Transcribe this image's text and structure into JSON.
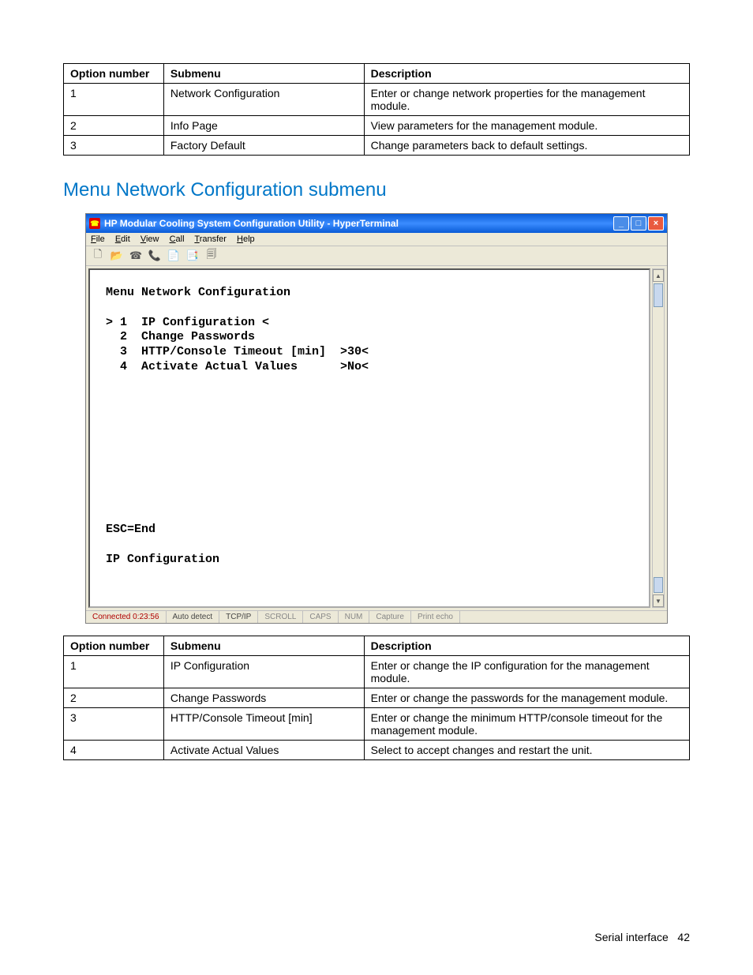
{
  "table1": {
    "headers": {
      "c1": "Option number",
      "c2": "Submenu",
      "c3": "Description"
    },
    "rows": [
      {
        "c1": "1",
        "c2": "Network Configuration",
        "c3": "Enter or change network properties for the management module."
      },
      {
        "c1": "2",
        "c2": "Info Page",
        "c3": "View parameters for the management module."
      },
      {
        "c1": "3",
        "c2": "Factory Default",
        "c3": "Change parameters back to default settings."
      }
    ]
  },
  "heading": "Menu Network Configuration submenu",
  "window": {
    "title": "HP Modular Cooling System Configuration Utility - HyperTerminal",
    "menus": {
      "file": "File",
      "edit": "Edit",
      "view": "View",
      "call": "Call",
      "transfer": "Transfer",
      "help": "Help"
    },
    "terminal_text": "Menu Network Configuration\n\n> 1  IP Configuration <\n  2  Change Passwords\n  3  HTTP/Console Timeout [min]  >30<\n  4  Activate Actual Values      >No<\n\n\n\n\n\n\n\n\n\n\nESC=End\n\nIP Configuration",
    "status": {
      "connected": "Connected 0:23:56",
      "auto": "Auto detect",
      "proto": "TCP/IP",
      "scroll": "SCROLL",
      "caps": "CAPS",
      "num": "NUM",
      "capture": "Capture",
      "echo": "Print echo"
    }
  },
  "table2": {
    "headers": {
      "c1": "Option number",
      "c2": "Submenu",
      "c3": "Description"
    },
    "rows": [
      {
        "c1": "1",
        "c2": "IP Configuration",
        "c3": "Enter or change the IP configuration for the management module."
      },
      {
        "c1": "2",
        "c2": "Change Passwords",
        "c3": "Enter or change the passwords for the management module."
      },
      {
        "c1": "3",
        "c2": "HTTP/Console Timeout [min]",
        "c3": "Enter or change the minimum HTTP/console timeout for the management module."
      },
      {
        "c1": "4",
        "c2": "Activate Actual Values",
        "c3": "Select to accept changes and restart the unit."
      }
    ]
  },
  "footer": {
    "text": "Serial interface",
    "page": "42"
  }
}
